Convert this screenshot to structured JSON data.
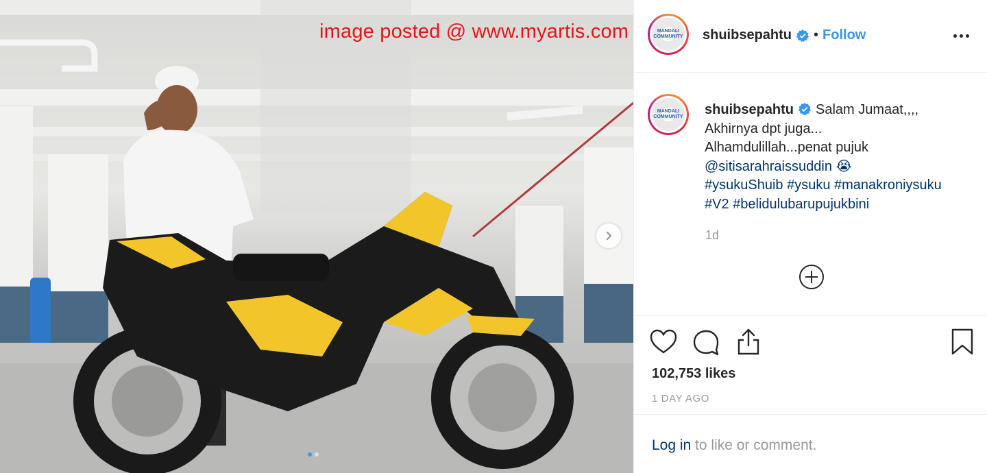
{
  "watermark": "image posted @ www.myartis.com",
  "carousel": {
    "total_slides": 2,
    "active_slide": 1
  },
  "avatar_badge": {
    "line1": "MANDALI",
    "line2": "COMMUNITY"
  },
  "header": {
    "username": "shuibsepahtu",
    "separator": "•",
    "follow_label": "Follow"
  },
  "caption": {
    "username": "shuibsepahtu",
    "lines": [
      "Salam Jumaat,,,,",
      "Akhirnya dpt juga...",
      "Alhamdulillah...penat pujuk",
      "@sitisarahraissuddin 😭",
      "#ysukuShuib #ysuku #manakroniysuku",
      "#V2 #belidulubarupujukbini"
    ],
    "time_ago": "1d"
  },
  "engagement": {
    "likes": "102,753 likes",
    "date": "1 DAY AGO"
  },
  "footer": {
    "login_label": "Log in",
    "login_suffix": " to like or comment."
  },
  "colors": {
    "accent": "#3897f0",
    "watermark": "#e8141a",
    "tag": "#003569",
    "muted": "#999999"
  },
  "icons": [
    "verified-icon",
    "more-options-icon",
    "chevron-right-icon",
    "add-comment-icon",
    "heart-icon",
    "comment-icon",
    "share-icon",
    "bookmark-icon"
  ]
}
